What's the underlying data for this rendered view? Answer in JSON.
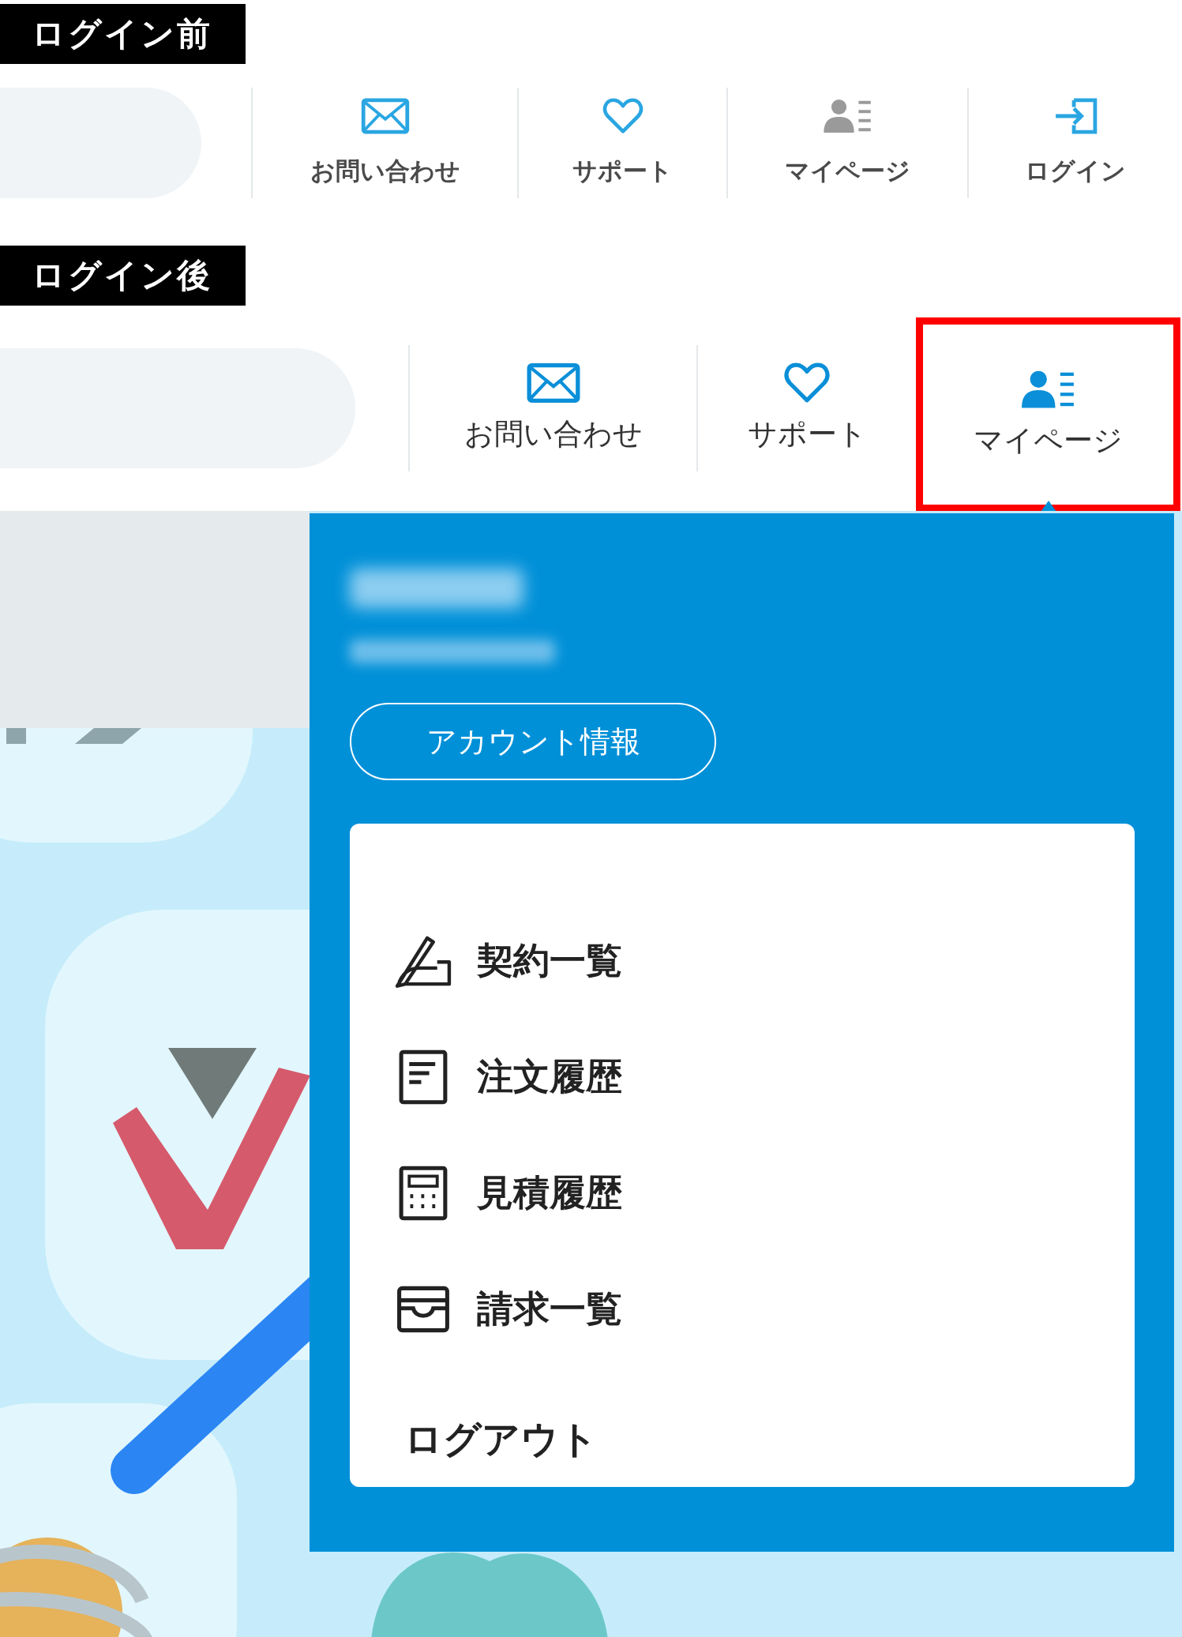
{
  "sections": [
    {
      "label": "ログイン前",
      "nav_items": [
        {
          "label": "お問い合わせ",
          "kind": "mail",
          "disabled": false,
          "selected": false
        },
        {
          "label": "サポート",
          "kind": "heart",
          "disabled": false,
          "selected": false
        },
        {
          "label": "マイページ",
          "kind": "user",
          "disabled": true,
          "selected": false
        },
        {
          "label": "ログイン",
          "kind": "login",
          "disabled": false,
          "selected": false
        }
      ]
    },
    {
      "label": "ログイン後",
      "nav_items": [
        {
          "label": "お問い合わせ",
          "kind": "mail",
          "disabled": false,
          "selected": false
        },
        {
          "label": "サポート",
          "kind": "heart",
          "disabled": false,
          "selected": false
        },
        {
          "label": "マイページ",
          "kind": "user",
          "disabled": false,
          "selected": true
        }
      ]
    }
  ],
  "dropdown": {
    "account_button": "アカウント情報",
    "items": [
      {
        "label": "契約一覧",
        "kind": "sign"
      },
      {
        "label": "注文履歴",
        "kind": "doc"
      },
      {
        "label": "見積履歴",
        "kind": "calc"
      },
      {
        "label": "請求一覧",
        "kind": "tray"
      }
    ],
    "logout": "ログアウト"
  }
}
